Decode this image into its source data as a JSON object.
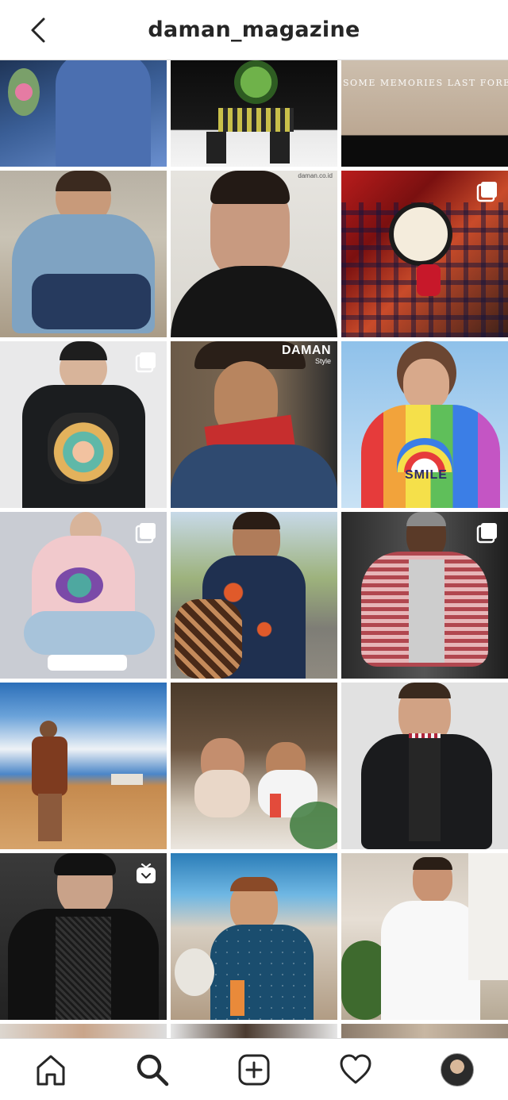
{
  "header": {
    "title": "daman_magazine",
    "back_icon": "chevron-left-icon"
  },
  "grid": {
    "tiles": [
      {
        "label": "post-1",
        "badge": null
      },
      {
        "label": "post-2",
        "badge": null
      },
      {
        "label": "post-3",
        "badge": null,
        "overlay_text": "SOME MEMORIES LAST FOREVER"
      },
      {
        "label": "post-4",
        "badge": null
      },
      {
        "label": "post-5",
        "badge": null,
        "overlay_text": "daman.co.id"
      },
      {
        "label": "post-6",
        "badge": "carousel"
      },
      {
        "label": "post-7",
        "badge": "carousel"
      },
      {
        "label": "post-8",
        "badge": null,
        "logo": "DAMAN",
        "logo_sub": "Style"
      },
      {
        "label": "post-9",
        "badge": null,
        "shirt_text": "SMILE"
      },
      {
        "label": "post-10",
        "badge": "carousel"
      },
      {
        "label": "post-11",
        "badge": null
      },
      {
        "label": "post-12",
        "badge": "carousel"
      },
      {
        "label": "post-13",
        "badge": null
      },
      {
        "label": "post-14",
        "badge": null
      },
      {
        "label": "post-15",
        "badge": null
      },
      {
        "label": "post-16",
        "badge": "igtv"
      },
      {
        "label": "post-17",
        "badge": null
      },
      {
        "label": "post-18",
        "badge": null
      }
    ]
  },
  "tabbar": {
    "items": [
      {
        "name": "home",
        "icon": "home-icon"
      },
      {
        "name": "search",
        "icon": "search-icon",
        "active": true
      },
      {
        "name": "new-post",
        "icon": "plus-square-icon"
      },
      {
        "name": "activity",
        "icon": "heart-icon"
      },
      {
        "name": "profile",
        "icon": "avatar"
      }
    ]
  },
  "colors": {
    "border": "#dbdbdb",
    "text": "#262626",
    "background": "#ffffff"
  }
}
